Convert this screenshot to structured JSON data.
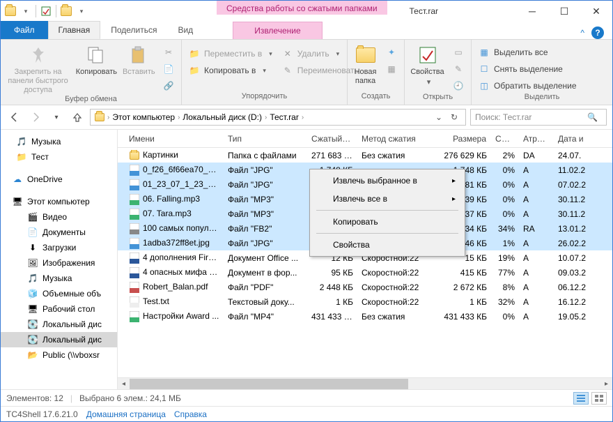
{
  "title": "Тест.rar",
  "context_tab_group": "Средства работы со сжатыми папками",
  "context_tab": "Извлечение",
  "tabs": {
    "file": "Файл",
    "home": "Главная",
    "share": "Поделиться",
    "view": "Вид"
  },
  "ribbon": {
    "clipboard": {
      "label": "Буфер обмена",
      "pin": "Закрепить на панели\nбыстрого доступа",
      "copy": "Копировать",
      "paste": "Вставить"
    },
    "organize": {
      "label": "Упорядочить",
      "move": "Переместить в",
      "copyto": "Копировать в",
      "delete": "Удалить",
      "rename": "Переименовать"
    },
    "new": {
      "label": "Создать",
      "newfolder": "Новая\nпапка"
    },
    "open": {
      "label": "Открыть",
      "properties": "Свойства"
    },
    "select": {
      "label": "Выделить",
      "all": "Выделить все",
      "none": "Снять выделение",
      "invert": "Обратить выделение"
    }
  },
  "breadcrumbs": [
    "Этот компьютер",
    "Локальный диск (D:)",
    "Тест.rar"
  ],
  "search_placeholder": "Поиск: Тест.rar",
  "columns": {
    "name": "Имени",
    "type": "Тип",
    "compressed": "Сжатый р...",
    "method": "Метод сжатия",
    "size": "Размера",
    "ratio": "Сжа...",
    "attr": "Атрибу...",
    "date": "Дата и"
  },
  "sidebar": {
    "top": [
      {
        "icon": "music",
        "label": "Музыка"
      },
      {
        "icon": "folder",
        "label": "Тест"
      }
    ],
    "onedrive": "OneDrive",
    "thispc": "Этот компьютер",
    "pc_items": [
      {
        "icon": "video",
        "label": "Видео"
      },
      {
        "icon": "doc",
        "label": "Документы"
      },
      {
        "icon": "download",
        "label": "Загрузки"
      },
      {
        "icon": "image",
        "label": "Изображения"
      },
      {
        "icon": "music",
        "label": "Музыка"
      },
      {
        "icon": "cube",
        "label": "Объемные объ"
      },
      {
        "icon": "desktop",
        "label": "Рабочий стол"
      },
      {
        "icon": "disk",
        "label": "Локальный дис"
      },
      {
        "icon": "disk",
        "label": "Локальный дис",
        "sel": true
      },
      {
        "icon": "netfolder",
        "label": "Public (\\\\vboxsr"
      }
    ]
  },
  "rows": [
    {
      "sel": false,
      "icon": "folder",
      "name": "Картинки",
      "type": "Папка с файлами",
      "comp": "271 683 КБ",
      "method": "Без сжатия",
      "size": "276 629 КБ",
      "ratio": "2%",
      "attr": "DA",
      "date": "24.07."
    },
    {
      "sel": true,
      "icon": "jpg",
      "name": "0_f26_6f66ea70_orig...",
      "type": "Файл \"JPG\"",
      "comp": "1 748 КБ",
      "method": "",
      "size": "1 748 КБ",
      "ratio": "0%",
      "attr": "A",
      "date": "11.02.2"
    },
    {
      "sel": true,
      "icon": "jpg",
      "name": "01_23_07_1_23_47_...",
      "type": "Файл \"JPG\"",
      "comp": "",
      "method": "",
      "size": "81 КБ",
      "ratio": "0%",
      "attr": "A",
      "date": "07.02.2"
    },
    {
      "sel": true,
      "icon": "mp3",
      "name": "06. Falling.mp3",
      "type": "Файл \"MP3\"",
      "comp": "",
      "method": "",
      "size": "239 КБ",
      "ratio": "0%",
      "attr": "A",
      "date": "30.11.2"
    },
    {
      "sel": true,
      "icon": "mp3",
      "name": "07. Tara.mp3",
      "type": "Файл \"MP3\"",
      "comp": "",
      "method": "",
      "size": "937 КБ",
      "ratio": "0%",
      "attr": "A",
      "date": "30.11.2"
    },
    {
      "sel": true,
      "icon": "fb2",
      "name": "100 самых популя...",
      "type": "Файл \"FB2\"",
      "comp": "",
      "method": "",
      "size": "634 КБ",
      "ratio": "34%",
      "attr": "RA",
      "date": "13.01.2"
    },
    {
      "sel": true,
      "icon": "jpg",
      "name": "1adba372ff8et.jpg",
      "type": "Файл \"JPG\"",
      "comp": "",
      "method": "",
      "size": "46 КБ",
      "ratio": "1%",
      "attr": "A",
      "date": "26.02.2"
    },
    {
      "sel": false,
      "icon": "docx",
      "name": "4 дополнения Firef...",
      "type": "Документ Office ...",
      "comp": "12 КБ",
      "method": "Скоростной:22",
      "size": "15 КБ",
      "ratio": "19%",
      "attr": "A",
      "date": "10.07.2"
    },
    {
      "sel": false,
      "icon": "docx",
      "name": "4 опасных мифа о ...",
      "type": "Документ в фор...",
      "comp": "95 КБ",
      "method": "Скоростной:22",
      "size": "415 КБ",
      "ratio": "77%",
      "attr": "A",
      "date": "09.03.2"
    },
    {
      "sel": false,
      "icon": "pdf",
      "name": "Robert_Balan.pdf",
      "type": "Файл \"PDF\"",
      "comp": "2 448 КБ",
      "method": "Скоростной:22",
      "size": "2 672 КБ",
      "ratio": "8%",
      "attr": "A",
      "date": "06.12.2"
    },
    {
      "sel": false,
      "icon": "txt",
      "name": "Test.txt",
      "type": "Текстовый доку...",
      "comp": "1 КБ",
      "method": "Скоростной:22",
      "size": "1 КБ",
      "ratio": "32%",
      "attr": "A",
      "date": "16.12.2"
    },
    {
      "sel": false,
      "icon": "mp4",
      "name": "Настройки Award ...",
      "type": "Файл \"MP4\"",
      "comp": "431 433 КБ",
      "method": "Без сжатия",
      "size": "431 433 КБ",
      "ratio": "0%",
      "attr": "A",
      "date": "19.05.2"
    }
  ],
  "context_menu": {
    "extract_sel": "Извлечь выбранное в",
    "extract_all": "Извлечь все в",
    "copy": "Копировать",
    "properties": "Свойства"
  },
  "status": {
    "count": "Элементов: 12",
    "selection": "Выбрано 6 элем.: 24,1 МБ"
  },
  "footer": {
    "version": "TC4Shell 17.6.21.0",
    "home": "Домашняя страница",
    "help": "Справка"
  }
}
